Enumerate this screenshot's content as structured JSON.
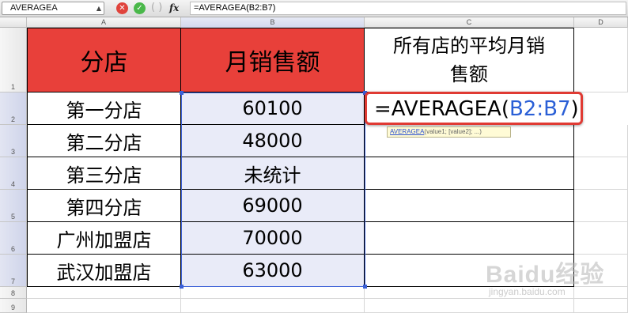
{
  "formula_bar": {
    "name_box": "AVERAGEA",
    "fx_label": "fx",
    "formula": "=AVERAGEA(B2:B7)"
  },
  "columns": [
    "A",
    "B",
    "C",
    "D"
  ],
  "rows": [
    "1",
    "2",
    "3",
    "4",
    "5",
    "6",
    "7",
    "8",
    "9"
  ],
  "header": {
    "a1": "分店",
    "b1": "月销售额",
    "c1": "所有店的平均月销售额"
  },
  "table": [
    {
      "store": "第一分店",
      "sales": "60100"
    },
    {
      "store": "第二分店",
      "sales": "48000"
    },
    {
      "store": "第三分店",
      "sales": "未统计"
    },
    {
      "store": "第四分店",
      "sales": "69000"
    },
    {
      "store": "广州加盟店",
      "sales": "70000"
    },
    {
      "store": "武汉加盟店",
      "sales": "63000"
    }
  ],
  "editing": {
    "prefix": "=AVERAGEA(",
    "range": "B2:B7",
    "suffix": ")"
  },
  "tooltip": {
    "function": "AVERAGEA",
    "args": "(value1; [value2]; ...)"
  },
  "watermark": {
    "brand": "Baidu经验",
    "url": "jingyan.baidu.com"
  },
  "colors": {
    "header_fill": "#e8403a",
    "selection_fill": "#e9ebf8",
    "highlight_border": "#e03a33",
    "reference_blue": "#2a5fd6"
  }
}
